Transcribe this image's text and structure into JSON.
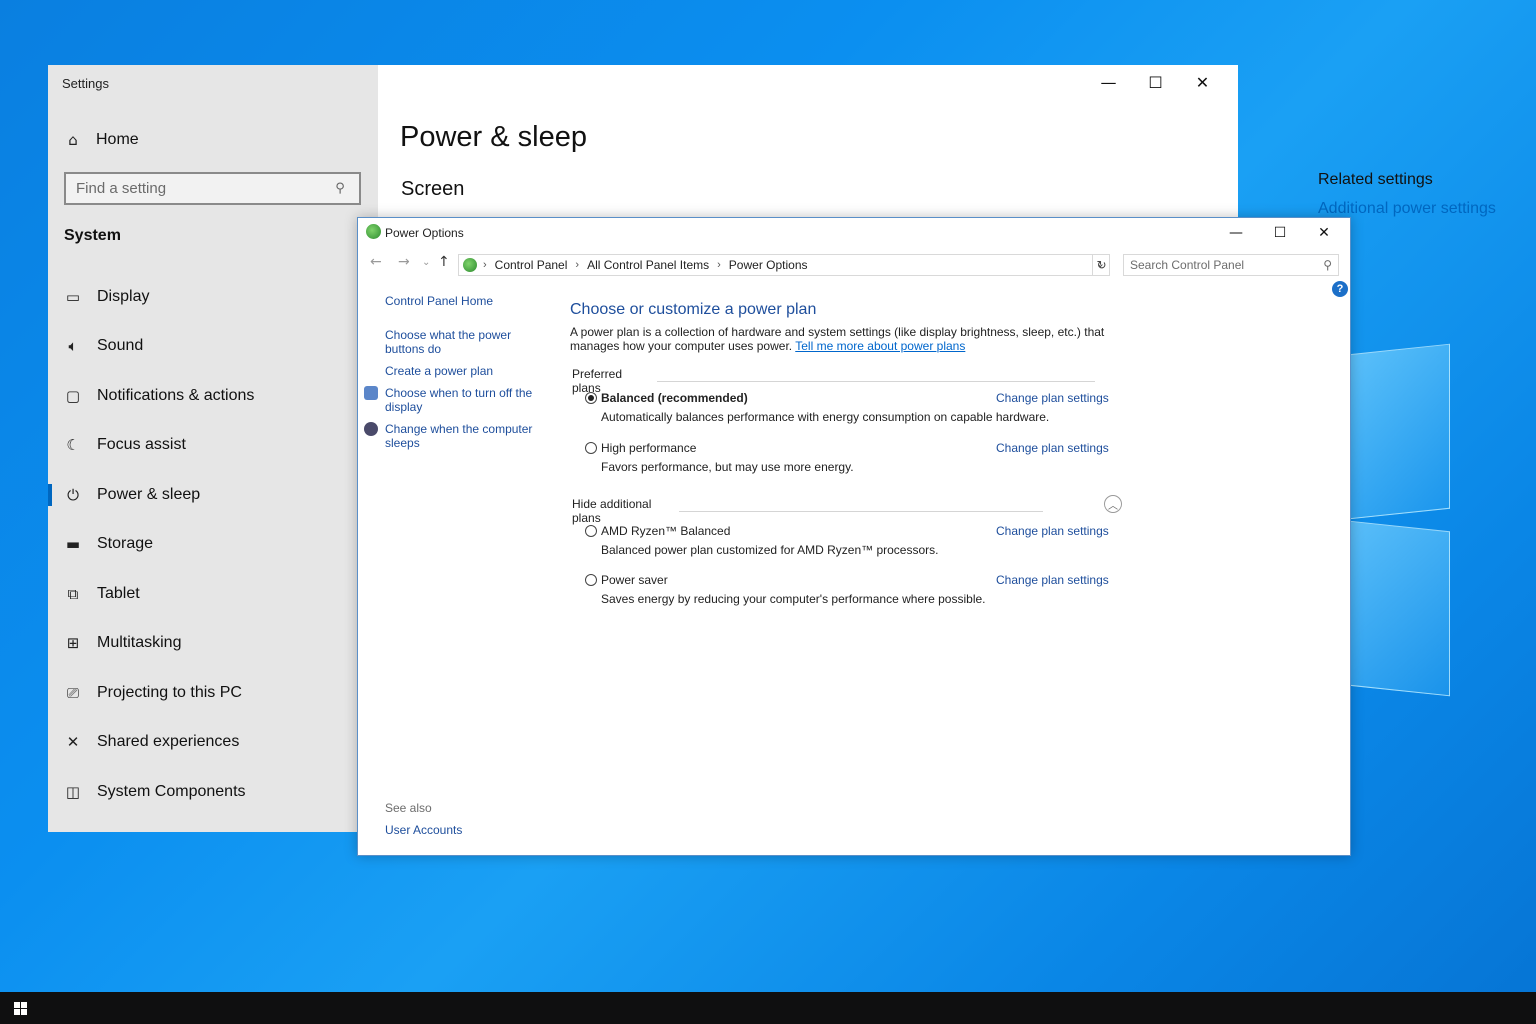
{
  "settings": {
    "window_title": "Settings",
    "nav": {
      "home": "Home",
      "search_placeholder": "Find a setting",
      "section": "System",
      "items": [
        {
          "label": "Display",
          "icon": "monitor-icon"
        },
        {
          "label": "Sound",
          "icon": "speaker-icon"
        },
        {
          "label": "Notifications & actions",
          "icon": "notification-icon"
        },
        {
          "label": "Focus assist",
          "icon": "moon-icon"
        },
        {
          "label": "Power & sleep",
          "icon": "power-icon",
          "active": true
        },
        {
          "label": "Storage",
          "icon": "storage-icon"
        },
        {
          "label": "Tablet",
          "icon": "tablet-icon"
        },
        {
          "label": "Multitasking",
          "icon": "multitasking-icon"
        },
        {
          "label": "Projecting to this PC",
          "icon": "projector-icon"
        },
        {
          "label": "Shared experiences",
          "icon": "shared-icon"
        },
        {
          "label": "System Components",
          "icon": "components-icon"
        }
      ]
    },
    "page_title": "Power & sleep",
    "section_title": "Screen",
    "related_title": "Related settings",
    "related_link": "Additional power settings"
  },
  "power_options": {
    "window_title": "Power Options",
    "breadcrumb": [
      "Control Panel",
      "All Control Panel Items",
      "Power Options"
    ],
    "search_placeholder": "Search Control Panel",
    "left": {
      "home": "Control Panel Home",
      "links": [
        "Choose what the power buttons do",
        "Create a power plan",
        "Choose when to turn off the display",
        "Change when the computer sleeps"
      ],
      "see_also": "See also",
      "user_accounts": "User Accounts"
    },
    "heading": "Choose or customize a power plan",
    "description": "A power plan is a collection of hardware and system settings (like display brightness, sleep, etc.) that manages how your computer uses power.",
    "learn_more": "Tell me more about power plans",
    "preferred_label": "Preferred plans",
    "hide_label": "Hide additional plans",
    "change_label": "Change plan settings",
    "plans": [
      {
        "name": "Balanced (recommended)",
        "desc": "Automatically balances performance with energy consumption on capable hardware.",
        "selected": true
      },
      {
        "name": "High performance",
        "desc": "Favors performance, but may use more energy.",
        "selected": false
      },
      {
        "name": "AMD Ryzen™ Balanced",
        "desc": "Balanced power plan customized for AMD Ryzen™ processors.",
        "selected": false
      },
      {
        "name": "Power saver",
        "desc": "Saves energy by reducing your computer's performance where possible.",
        "selected": false
      }
    ]
  },
  "colors": {
    "accent": "#0067c0",
    "link": "#1e4e9c",
    "desktop": "#0a86e6"
  }
}
